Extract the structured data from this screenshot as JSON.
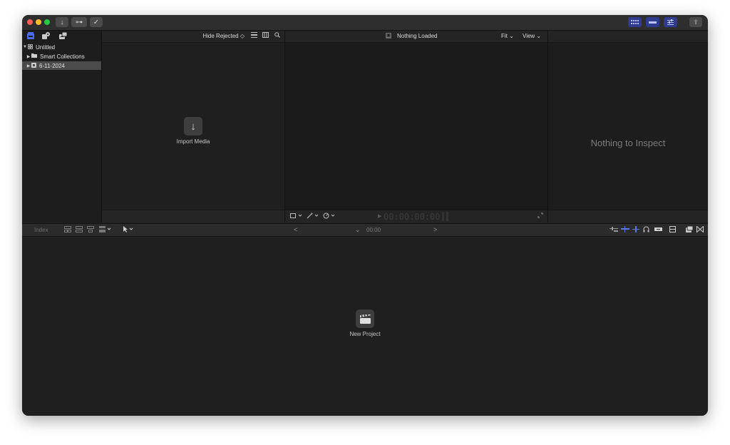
{
  "titlebar": {
    "buttons": {
      "import": "↓",
      "keywords": "⊶",
      "background_tasks": "✓"
    },
    "share": "⇪"
  },
  "library": {
    "tools": [
      "libraries-icon",
      "photos-audio-icon",
      "titles-generators-icon"
    ],
    "items": [
      {
        "label": "Untitled",
        "icon": "library-icon",
        "disclosure": "▼"
      },
      {
        "label": "Smart Collections",
        "icon": "folder-icon",
        "disclosure": "▶"
      },
      {
        "label": "6-11-2024",
        "icon": "event-icon",
        "disclosure": "▶"
      }
    ]
  },
  "browser": {
    "filter": "Hide Rejected ◇",
    "import_label": "Import Media",
    "import_icon": "↓"
  },
  "viewer": {
    "title": "Nothing Loaded",
    "fit": "Fit ⌄",
    "view": "View ⌄",
    "timecode": "00:00:00:00",
    "play": "▶"
  },
  "inspector": {
    "empty_message": "Nothing to Inspect"
  },
  "timeline_toolbar": {
    "index": "Index",
    "prev": "<",
    "next": ">",
    "dropdown": "⌄",
    "time": "00:00"
  },
  "timeline": {
    "new_project_label": "New Project"
  },
  "colors": {
    "window_bg": "#1f1f1f",
    "titlebar": "#2e2e2e",
    "accent_blue": "#2f3b8f",
    "selection": "#4b4b4b",
    "traffic_red": "#ff5f57",
    "traffic_yellow": "#febc2e",
    "traffic_green": "#28c840"
  }
}
